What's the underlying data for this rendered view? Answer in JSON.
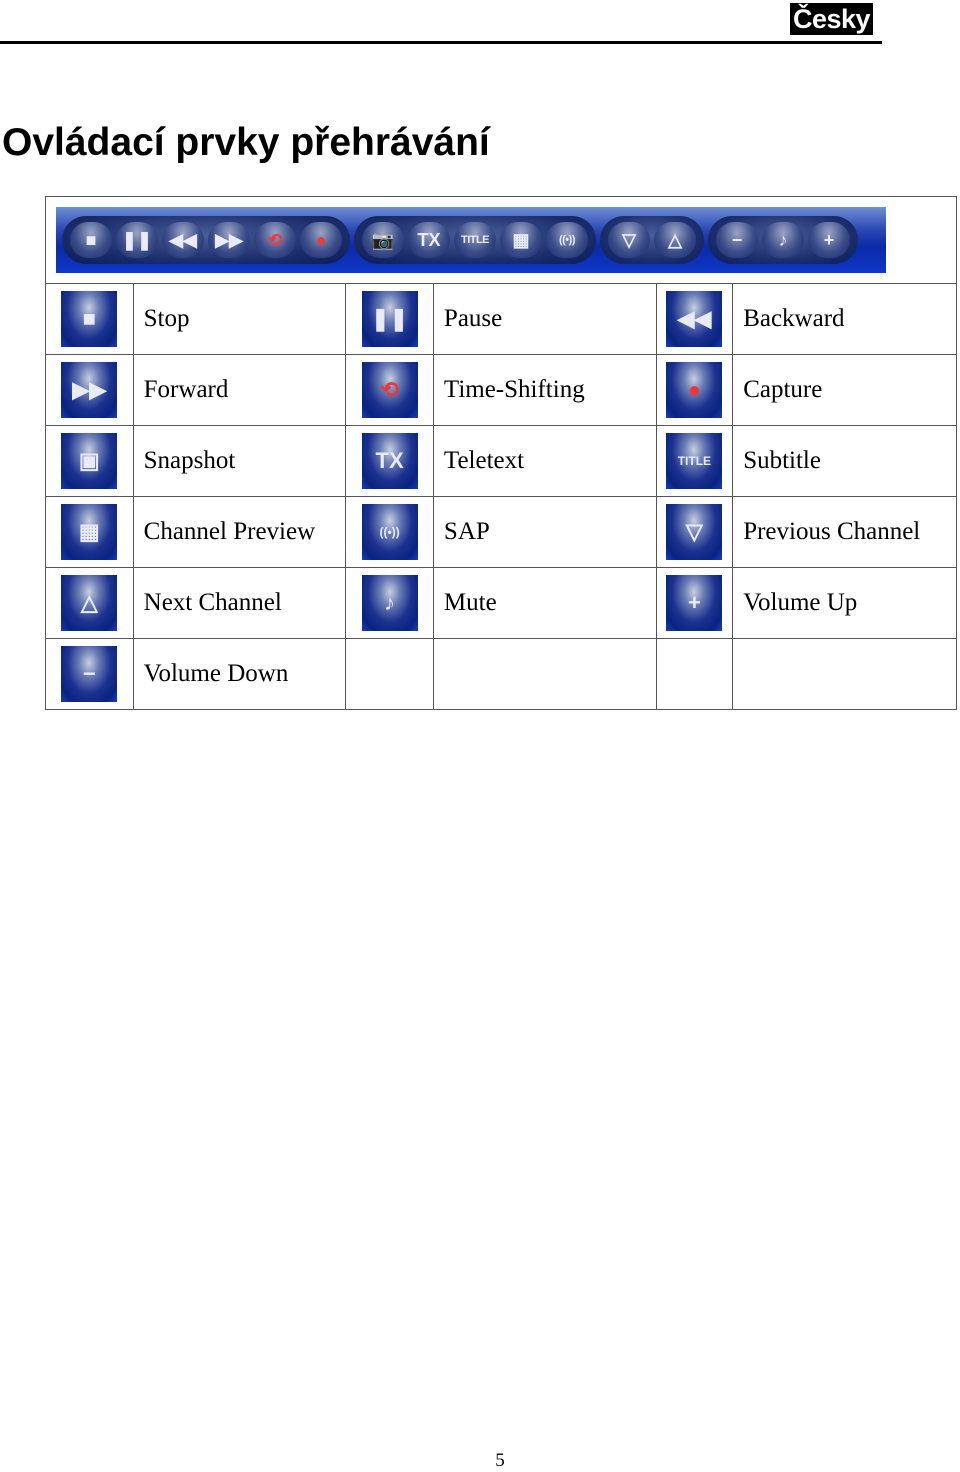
{
  "header": {
    "language_badge": "Česky"
  },
  "page_title": "Ovládací prvky přehrávání",
  "toolbar": {
    "groups": [
      [
        {
          "icon": "stop-icon",
          "glyph": "■"
        },
        {
          "icon": "pause-icon",
          "glyph": "❚❚"
        },
        {
          "icon": "backward-icon",
          "glyph": "◀◀"
        },
        {
          "icon": "forward-icon",
          "glyph": "▶▶"
        },
        {
          "icon": "time-shifting-icon",
          "glyph": "⟲"
        },
        {
          "icon": "capture-icon",
          "glyph": "●"
        }
      ],
      [
        {
          "icon": "snapshot-icon",
          "glyph": "📷"
        },
        {
          "icon": "teletext-icon",
          "glyph": "TX"
        },
        {
          "icon": "subtitle-icon",
          "glyph": "TITLE"
        },
        {
          "icon": "channel-preview-icon",
          "glyph": "▦"
        },
        {
          "icon": "sap-icon",
          "glyph": "((•))"
        }
      ],
      [
        {
          "icon": "previous-channel-icon",
          "glyph": "▽"
        },
        {
          "icon": "next-channel-icon",
          "glyph": "△"
        }
      ],
      [
        {
          "icon": "volume-down-icon",
          "glyph": "−"
        },
        {
          "icon": "mute-icon",
          "glyph": "♪"
        },
        {
          "icon": "volume-up-icon",
          "glyph": "+"
        }
      ]
    ]
  },
  "controls": [
    {
      "label": "Stop",
      "icon": "stop-icon",
      "glyph": "■"
    },
    {
      "label": "Pause",
      "icon": "pause-icon",
      "glyph": "❚❚"
    },
    {
      "label": "Backward",
      "icon": "backward-icon",
      "glyph": "◀◀"
    },
    {
      "label": "Forward",
      "icon": "forward-icon",
      "glyph": "▶▶"
    },
    {
      "label": "Time-Shifting",
      "icon": "time-shifting-icon",
      "glyph": "⟲"
    },
    {
      "label": "Capture",
      "icon": "capture-icon",
      "glyph": "●"
    },
    {
      "label": "Snapshot",
      "icon": "snapshot-icon",
      "glyph": "▣"
    },
    {
      "label": "Teletext",
      "icon": "teletext-icon",
      "glyph": "TX"
    },
    {
      "label": "Subtitle",
      "icon": "subtitle-icon",
      "glyph": "TITLE"
    },
    {
      "label": "Channel Preview",
      "icon": "channel-preview-icon",
      "glyph": "▦"
    },
    {
      "label": "SAP",
      "icon": "sap-icon",
      "glyph": "((•))"
    },
    {
      "label": "Previous Channel",
      "icon": "previous-channel-icon",
      "glyph": "▽"
    },
    {
      "label": "Next Channel",
      "icon": "next-channel-icon",
      "glyph": "△"
    },
    {
      "label": "Mute",
      "icon": "mute-icon",
      "glyph": "♪"
    },
    {
      "label": "Volume Up",
      "icon": "volume-up-icon",
      "glyph": "+"
    },
    {
      "label": "Volume Down",
      "icon": "volume-down-icon",
      "glyph": "−"
    }
  ],
  "footer": {
    "page_number": "5"
  }
}
